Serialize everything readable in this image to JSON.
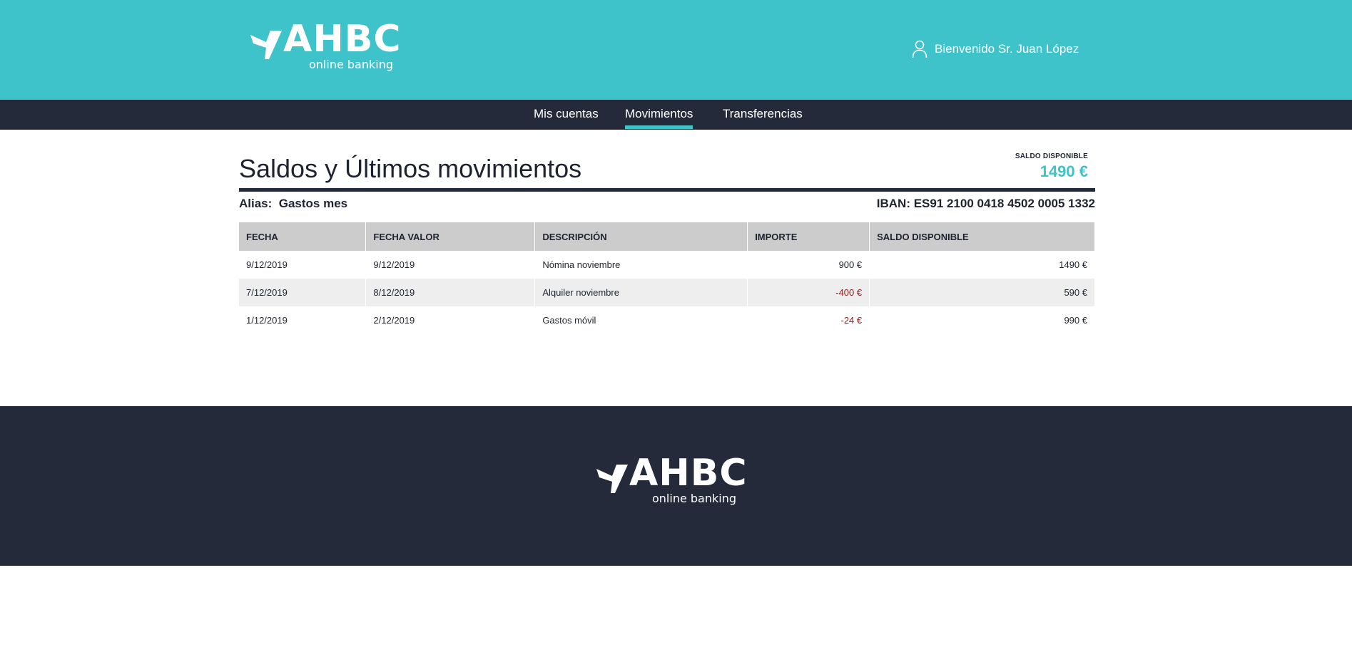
{
  "brand": {
    "name": "AHBC",
    "tagline": "online banking"
  },
  "header": {
    "welcome_text": "Bienvenido Sr. Juan López"
  },
  "nav": {
    "items": [
      {
        "label": "Mis cuentas",
        "active": false
      },
      {
        "label": "Movimientos",
        "active": true
      },
      {
        "label": "Transferencias",
        "active": false
      }
    ]
  },
  "main": {
    "title": "Saldos y Últimos movimientos",
    "saldo_label": "SALDO DISPONIBLE",
    "saldo_value": "1490 €",
    "alias_label": "Alias:",
    "alias_value": "Gastos mes",
    "iban": "IBAN: ES91 2100 0418 4502 0005 1332"
  },
  "table": {
    "headers": [
      "FECHA",
      "FECHA VALOR",
      "DESCRIPCIÓN",
      "IMPORTE",
      "SALDO DISPONIBLE"
    ],
    "rows": [
      {
        "fecha": "9/12/2019",
        "fecha_valor": "9/12/2019",
        "descripcion": "Nómina noviembre",
        "importe": "900 €",
        "saldo": "1490 €"
      },
      {
        "fecha": "7/12/2019",
        "fecha_valor": "8/12/2019",
        "descripcion": "Alquiler noviembre",
        "importe": "-400 €",
        "saldo": "590 €"
      },
      {
        "fecha": "1/12/2019",
        "fecha_valor": "2/12/2019",
        "descripcion": "Gastos móvil",
        "importe": "-24 €",
        "saldo": "990 €"
      }
    ]
  },
  "colors": {
    "accent": "#3ec3cb",
    "dark": "#252a3b",
    "negative": "#8b1b1b",
    "table_header": "#cccccc",
    "row_alt": "#eeeeee"
  },
  "icons": {
    "user": "user-icon",
    "logo": "bird-logo-icon"
  }
}
